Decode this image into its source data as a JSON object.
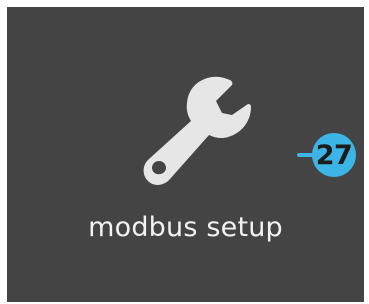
{
  "tile": {
    "label": "modbus setup",
    "icon": "wrench-icon"
  },
  "callout": {
    "number": "27"
  },
  "colors": {
    "tile_background": "#444444",
    "icon_fill": "#e6e6e6",
    "label_text": "#f2f2f2",
    "callout_accent": "#3cb4e6"
  }
}
